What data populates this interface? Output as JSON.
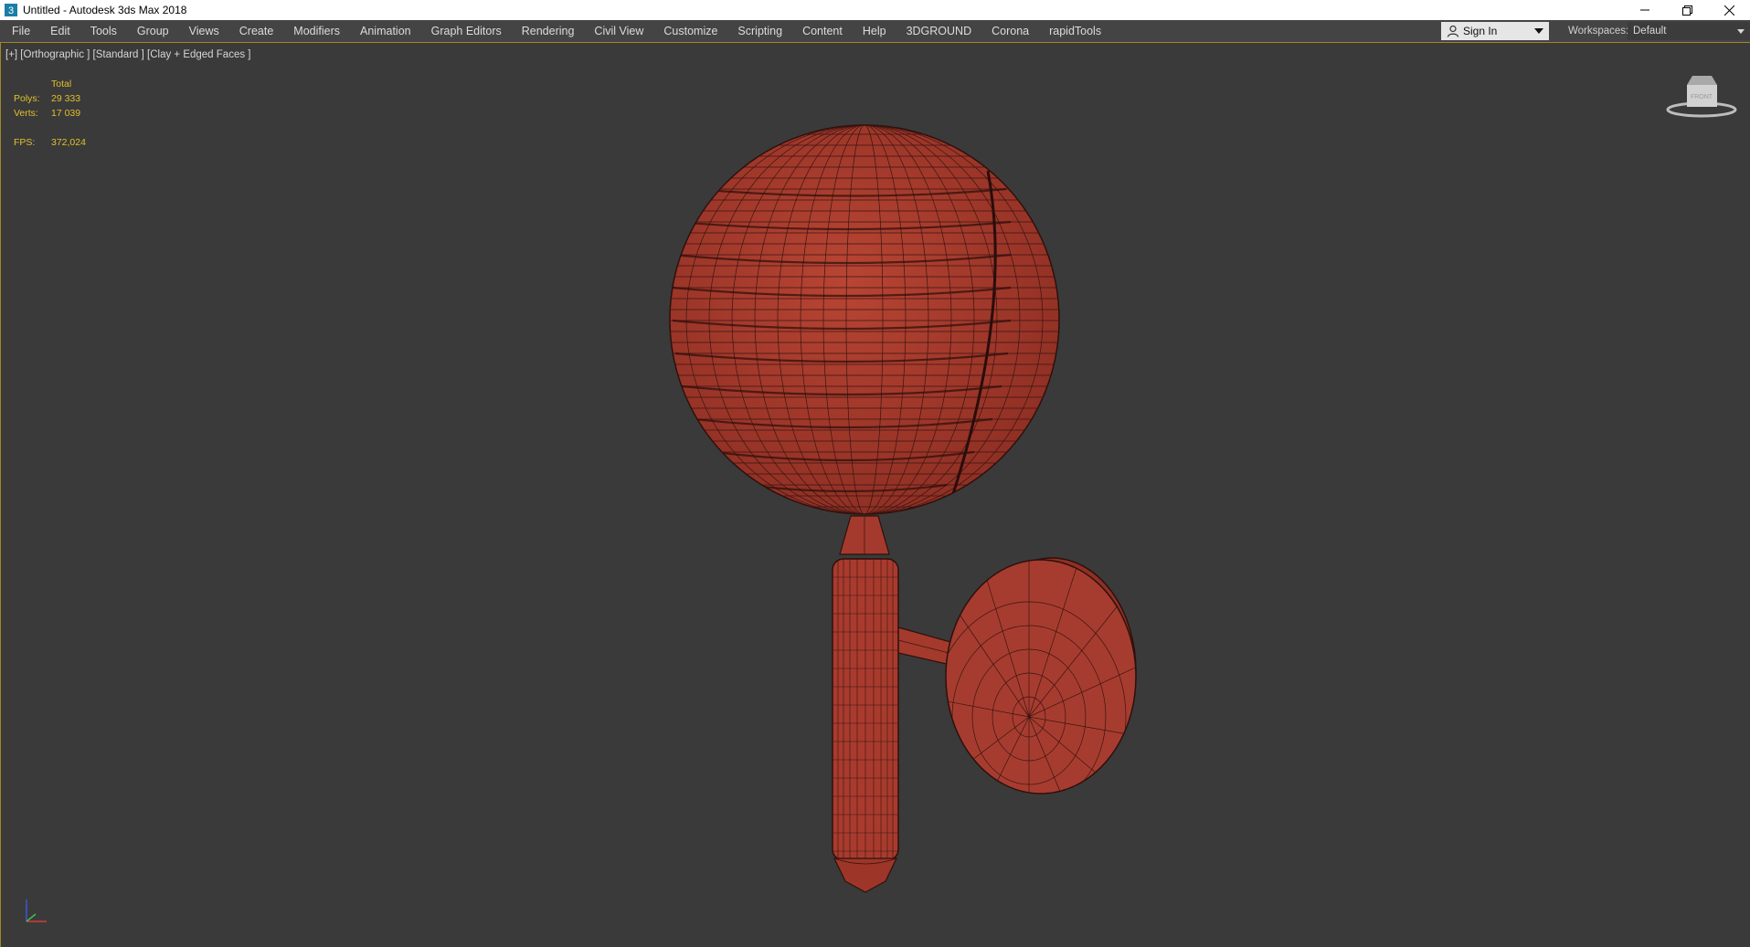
{
  "window": {
    "title": "Untitled - Autodesk 3ds Max 2018",
    "controls": [
      "minimize",
      "restore",
      "close"
    ]
  },
  "menu": {
    "items": [
      "File",
      "Edit",
      "Tools",
      "Group",
      "Views",
      "Create",
      "Modifiers",
      "Animation",
      "Graph Editors",
      "Rendering",
      "Civil View",
      "Customize",
      "Scripting",
      "Content",
      "Help",
      "3DGROUND",
      "Corona",
      "rapidTools"
    ]
  },
  "account": {
    "sign_in_label": "Sign In"
  },
  "workspaces": {
    "label": "Workspaces:",
    "selected": "Default"
  },
  "viewport": {
    "label": "[+] [Orthographic ] [Standard ] [Clay + Edged Faces ]",
    "stats": {
      "header": "Total",
      "polys_label": "Polys:",
      "polys_value": "29 333",
      "verts_label": "Verts:",
      "verts_value": "17 039",
      "fps_label": "FPS:",
      "fps_value": "372,024"
    }
  },
  "colors": {
    "viewport_bg": "#3a3a3a",
    "stats_text": "#e1c02c",
    "model_fill": "#a83b2e",
    "wire": "#3a1410",
    "accent_border": "#a0862a"
  },
  "icons": {
    "app": "3dsmax-app-icon",
    "user": "user-icon",
    "viewcube": "viewcube-icon",
    "axis": "axis-tripod-icon"
  }
}
